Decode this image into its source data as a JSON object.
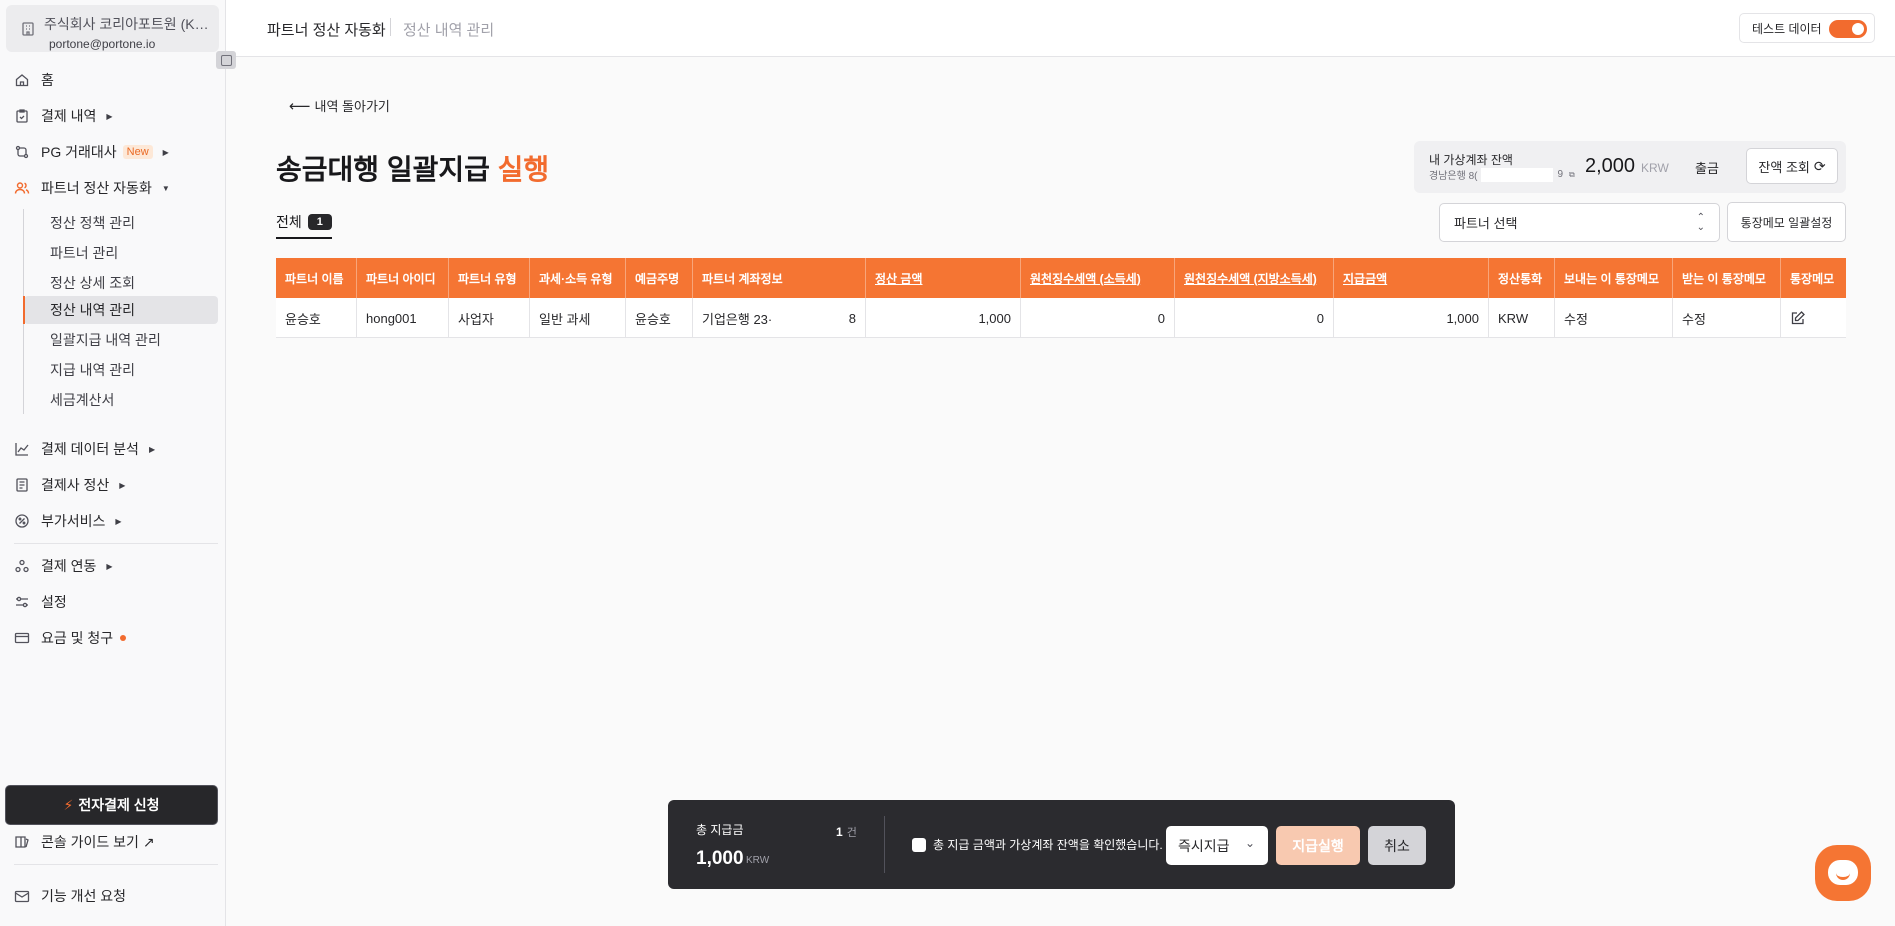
{
  "sidebar": {
    "org_name": "주식회사 코리아포트원 (Korea",
    "org_email": "portone@portone.io",
    "items": [
      {
        "label": "홈",
        "icon": "home-icon"
      },
      {
        "label": "결제 내역",
        "icon": "receipt-icon"
      },
      {
        "label": "PG 거래대사",
        "icon": "exchange-icon",
        "badge": "New"
      },
      {
        "label": "파트너 정산 자동화",
        "icon": "users-icon"
      },
      {
        "label": "결제 데이터 분석",
        "icon": "chart-icon"
      },
      {
        "label": "결제사 정산",
        "icon": "document-icon"
      },
      {
        "label": "부가서비스",
        "icon": "percent-icon"
      },
      {
        "label": "결제 연동",
        "icon": "shapes-icon"
      },
      {
        "label": "설정",
        "icon": "sliders-icon"
      },
      {
        "label": "요금 및 청구",
        "icon": "card-icon"
      }
    ],
    "sub_items": [
      "정산 정책 관리",
      "파트너 관리",
      "정산 상세 조회",
      "정산 내역 관리",
      "일괄지급 내역 관리",
      "지급 내역 관리",
      "세금계산서"
    ],
    "pay_button": "전자결제 신청",
    "guide_link": "콘솔 가이드 보기 ↗",
    "feedback": "기능 개선 요청"
  },
  "header": {
    "crumb1": "파트너 정산 자동화",
    "crumb2": "정산 내역 관리",
    "test_toggle": "테스트 데이터"
  },
  "main": {
    "back_link": "내역 돌아가기",
    "title_main": "송금대행 일괄지급",
    "title_accent": "실행",
    "balance": {
      "label": "내 가상계좌 잔액",
      "account_prefix": "경남은행 8(",
      "account_suffix": "9",
      "amount": "2,000",
      "unit": "KRW",
      "withdraw": "출금",
      "check_button": "잔액 조회"
    },
    "tab_all": "전체",
    "tab_count": "1",
    "partner_select": "파트너 선택",
    "memo_button": "통장메모 일괄설정"
  },
  "table": {
    "headers": [
      "파트너 이름",
      "파트너 아이디",
      "파트너 유형",
      "과세·소득 유형",
      "예금주명",
      "파트너 계좌정보",
      "정산 금액",
      "원천징수세액 (소득세)",
      "원천징수세액 (지방소득세)",
      "지급금액",
      "정산통화",
      "보내는 이 통장메모",
      "받는 이 통장메모",
      "통장메모"
    ],
    "rows": [
      {
        "name": "윤승호",
        "id": "hong001",
        "type": "사업자",
        "tax_type": "일반 과세",
        "holder": "윤승호",
        "account_bank": "기업은행 23·",
        "account_tail": "8",
        "settle_amount": "1,000",
        "income_tax": "0",
        "local_tax": "0",
        "pay_amount": "1,000",
        "currency": "KRW",
        "sender_memo": "수정",
        "receiver_memo": "수정"
      }
    ]
  },
  "action_bar": {
    "total_label": "총 지급금",
    "total_count": "1",
    "count_unit": "건",
    "total_amount": "1,000",
    "total_unit": "KRW",
    "confirm_text": "총 지급 금액과 가상계좌 잔액을 확인했습니다.",
    "mode": "즉시지급",
    "execute": "지급실행",
    "cancel": "취소"
  },
  "colors": {
    "accent": "#f26b2e",
    "table_header": "#f57533",
    "dark_bar": "#2b2b2f"
  }
}
